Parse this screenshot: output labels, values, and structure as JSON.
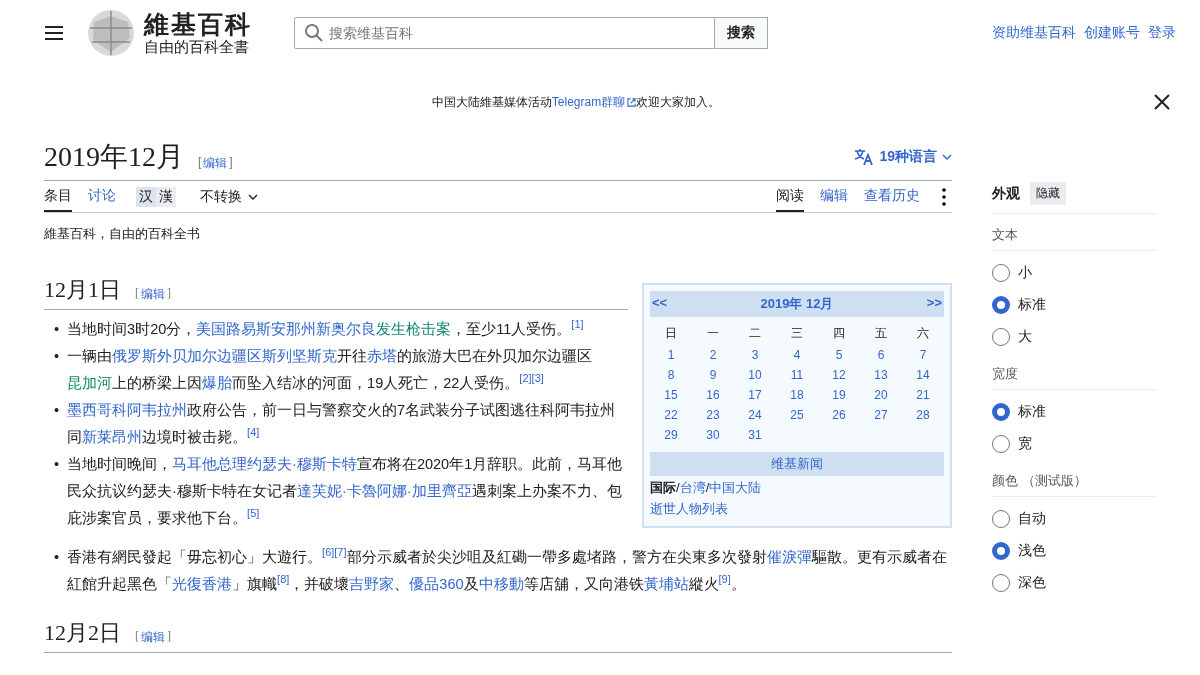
{
  "header": {
    "logo": {
      "wordmark": "維基百科",
      "tagline": "自由的百科全書"
    },
    "search": {
      "placeholder": "搜索维基百科",
      "button": "搜索"
    },
    "user_links": [
      "资助维基百科",
      "创建账号",
      "登录"
    ]
  },
  "banner": {
    "prefix": "中国大陆維基媒体活动",
    "link": "Telegram群聊",
    "suffix": "欢迎大家加入。"
  },
  "page": {
    "title": "2019年12月",
    "edit": {
      "open": "[",
      "label": "编辑",
      "close": "]"
    },
    "languages": "19种语言",
    "tabs_left": [
      {
        "label": "条目",
        "selected": true
      },
      {
        "label": "讨论",
        "selected": false
      }
    ],
    "variants": [
      {
        "label": "汉",
        "selected": true
      },
      {
        "label": "漢",
        "selected": false
      }
    ],
    "variant_menu": "不转换",
    "tabs_right": [
      {
        "label": "阅读",
        "selected": true
      },
      {
        "label": "编辑",
        "selected": false
      },
      {
        "label": "查看历史",
        "selected": false
      }
    ],
    "tagline": "維基百科，自由的百科全书"
  },
  "calendar": {
    "prev": "<<",
    "title": "2019年 12月",
    "next": ">>",
    "weekdays": [
      "日",
      "一",
      "二",
      "三",
      "四",
      "五",
      "六"
    ],
    "days": [
      "1",
      "2",
      "3",
      "4",
      "5",
      "6",
      "7",
      "8",
      "9",
      "10",
      "11",
      "12",
      "13",
      "14",
      "15",
      "16",
      "17",
      "18",
      "19",
      "20",
      "21",
      "22",
      "23",
      "24",
      "25",
      "26",
      "27",
      "28",
      "29",
      "30",
      "31"
    ],
    "footer_title": "维基新闻",
    "footer_lines": [
      [
        {
          "kind": "bold",
          "text": "国际"
        },
        {
          "kind": "text",
          "text": "/"
        },
        {
          "kind": "link",
          "text": "台湾"
        },
        {
          "kind": "text",
          "text": "/"
        },
        {
          "kind": "link",
          "text": "中国大陆"
        }
      ],
      [
        {
          "kind": "link",
          "text": "逝世人物列表"
        }
      ]
    ]
  },
  "sections": [
    {
      "heading": "12月1日",
      "bullet": "•",
      "edit": {
        "open": "[",
        "label": "编辑",
        "close": "]"
      },
      "items": [
        [
          {
            "kind": "text",
            "text": "当地时间3时20分，"
          },
          {
            "kind": "link",
            "text": "美国路易斯安那州新奥尔良"
          },
          {
            "kind": "interlink",
            "text": "发生枪击案"
          },
          {
            "kind": "text",
            "text": "，至少11人受伤。"
          },
          {
            "kind": "ref",
            "text": "[1]"
          }
        ],
        [
          {
            "kind": "text",
            "text": "一辆由"
          },
          {
            "kind": "link",
            "text": "俄罗斯外贝加尔边疆区斯列坚斯克"
          },
          {
            "kind": "text",
            "text": "开往"
          },
          {
            "kind": "link",
            "text": "赤塔"
          },
          {
            "kind": "text",
            "text": "的旅游大巴在外贝加尔边疆区"
          },
          {
            "kind": "interlink",
            "text": "昆加河"
          },
          {
            "kind": "text",
            "text": "上的桥梁上因"
          },
          {
            "kind": "link",
            "text": "爆胎"
          },
          {
            "kind": "text",
            "text": "而坠入结冰的河面，19人死亡，22人受伤。"
          },
          {
            "kind": "ref",
            "text": "[2]"
          },
          {
            "kind": "ref",
            "text": "[3]"
          }
        ],
        [
          {
            "kind": "link",
            "text": "墨西哥科阿韦拉州"
          },
          {
            "kind": "text",
            "text": "政府公告，前一日与警察交火的7名武装分子试图逃往科阿韦拉州同"
          },
          {
            "kind": "link",
            "text": "新莱昂州"
          },
          {
            "kind": "text",
            "text": "边境时被击毙。"
          },
          {
            "kind": "ref",
            "text": "[4]"
          }
        ],
        [
          {
            "kind": "text",
            "text": "当地时间晚间，"
          },
          {
            "kind": "link",
            "text": "马耳他总理约瑟夫·穆斯卡特"
          },
          {
            "kind": "text",
            "text": "宣布将在2020年1月辞职。此前，马耳他民众抗议约瑟夫·穆斯卡特在女记者"
          },
          {
            "kind": "link",
            "text": "達芙妮·卡魯阿娜·加里齊亞"
          },
          {
            "kind": "text",
            "text": "遇刺案上办案不力、包庇涉案官员，要求他下台。"
          },
          {
            "kind": "ref",
            "text": "[5]"
          }
        ],
        [
          {
            "kind": "text",
            "text": "香港有網民發起「毋忘初心」大遊行。"
          },
          {
            "kind": "ref",
            "text": "[6]"
          },
          {
            "kind": "ref",
            "text": "[7]"
          },
          {
            "kind": "text",
            "text": "部分示威者於尖沙咀及紅磡一帶多處堵路，警方在尖東多次發射"
          },
          {
            "kind": "link",
            "text": "催淚彈"
          },
          {
            "kind": "text",
            "text": "驅散。更有示威者在紅館升起黑色「"
          },
          {
            "kind": "link",
            "text": "光復香港"
          },
          {
            "kind": "text",
            "text": "」旗幟"
          },
          {
            "kind": "ref",
            "text": "[8]"
          },
          {
            "kind": "text",
            "text": "，并破壞"
          },
          {
            "kind": "link",
            "text": "吉野家"
          },
          {
            "kind": "text",
            "text": "、"
          },
          {
            "kind": "link",
            "text": "優品360"
          },
          {
            "kind": "text",
            "text": "及"
          },
          {
            "kind": "link",
            "text": "中移動"
          },
          {
            "kind": "text",
            "text": "等店舖，又向港铁"
          },
          {
            "kind": "link",
            "text": "黃埔站"
          },
          {
            "kind": "text",
            "text": "縱火"
          },
          {
            "kind": "ref",
            "text": "[9]"
          },
          {
            "kind": "text",
            "text": "。"
          }
        ]
      ]
    },
    {
      "heading": "12月2日",
      "edit": {
        "open": "[",
        "label": "编辑",
        "close": "]"
      }
    }
  ],
  "appearance": {
    "title": "外观",
    "hide_button": "隐藏",
    "groups": [
      {
        "heading": "文本",
        "options": [
          {
            "label": "小",
            "selected": false
          },
          {
            "label": "标准",
            "selected": true
          },
          {
            "label": "大",
            "selected": false
          }
        ]
      },
      {
        "heading": "宽度",
        "options": [
          {
            "label": "标准",
            "selected": true
          },
          {
            "label": "宽",
            "selected": false
          }
        ]
      },
      {
        "heading": "颜色 （测试版）",
        "options": [
          {
            "label": "自动",
            "selected": false
          },
          {
            "label": "浅色",
            "selected": true
          },
          {
            "label": "深色",
            "selected": false
          }
        ]
      }
    ]
  }
}
